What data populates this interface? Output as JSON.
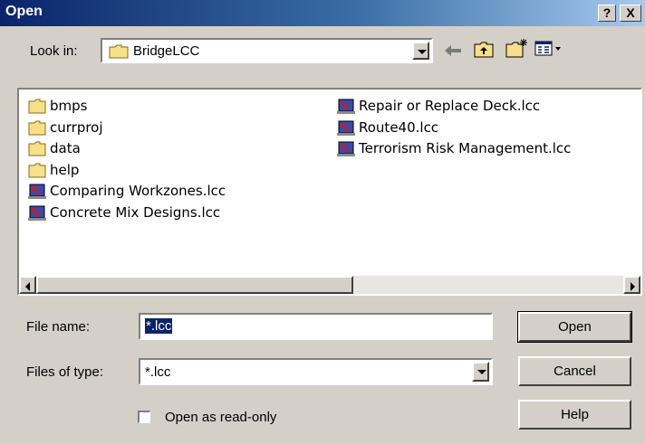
{
  "window": {
    "title": "Open",
    "help_glyph": "?",
    "close_glyph": "X"
  },
  "look_in": {
    "label": "Look in:",
    "folder": "BridgeLCC",
    "folder_icon": "folder-icon"
  },
  "toolbar": {
    "back_icon": "back-arrow-icon",
    "up_icon": "up-folder-icon",
    "new_folder_icon": "new-folder-icon",
    "view_menu_icon": "view-menu-icon"
  },
  "files": [
    {
      "name": "bmps",
      "type": "folder"
    },
    {
      "name": "currproj",
      "type": "folder"
    },
    {
      "name": "data",
      "type": "folder"
    },
    {
      "name": "help",
      "type": "folder"
    },
    {
      "name": "Comparing Workzones.lcc",
      "type": "lcc"
    },
    {
      "name": "Concrete Mix Designs.lcc",
      "type": "lcc"
    },
    {
      "name": "Repair or Replace Deck.lcc",
      "type": "lcc"
    },
    {
      "name": "Route40.lcc",
      "type": "lcc"
    },
    {
      "name": "Terrorism Risk Management.lcc",
      "type": "lcc"
    }
  ],
  "file_name": {
    "label": "File name:",
    "value": "*.lcc"
  },
  "file_type": {
    "label": "Files of type:",
    "value": "*.lcc"
  },
  "readonly": {
    "label": "Open as read-only",
    "checked": false
  },
  "buttons": {
    "open": "Open",
    "cancel": "Cancel",
    "help": "Help"
  },
  "colors": {
    "titlebar_start": "#0a246a",
    "titlebar_end": "#a6caf0",
    "face": "#d4d0c8",
    "selection": "#0a246a"
  }
}
